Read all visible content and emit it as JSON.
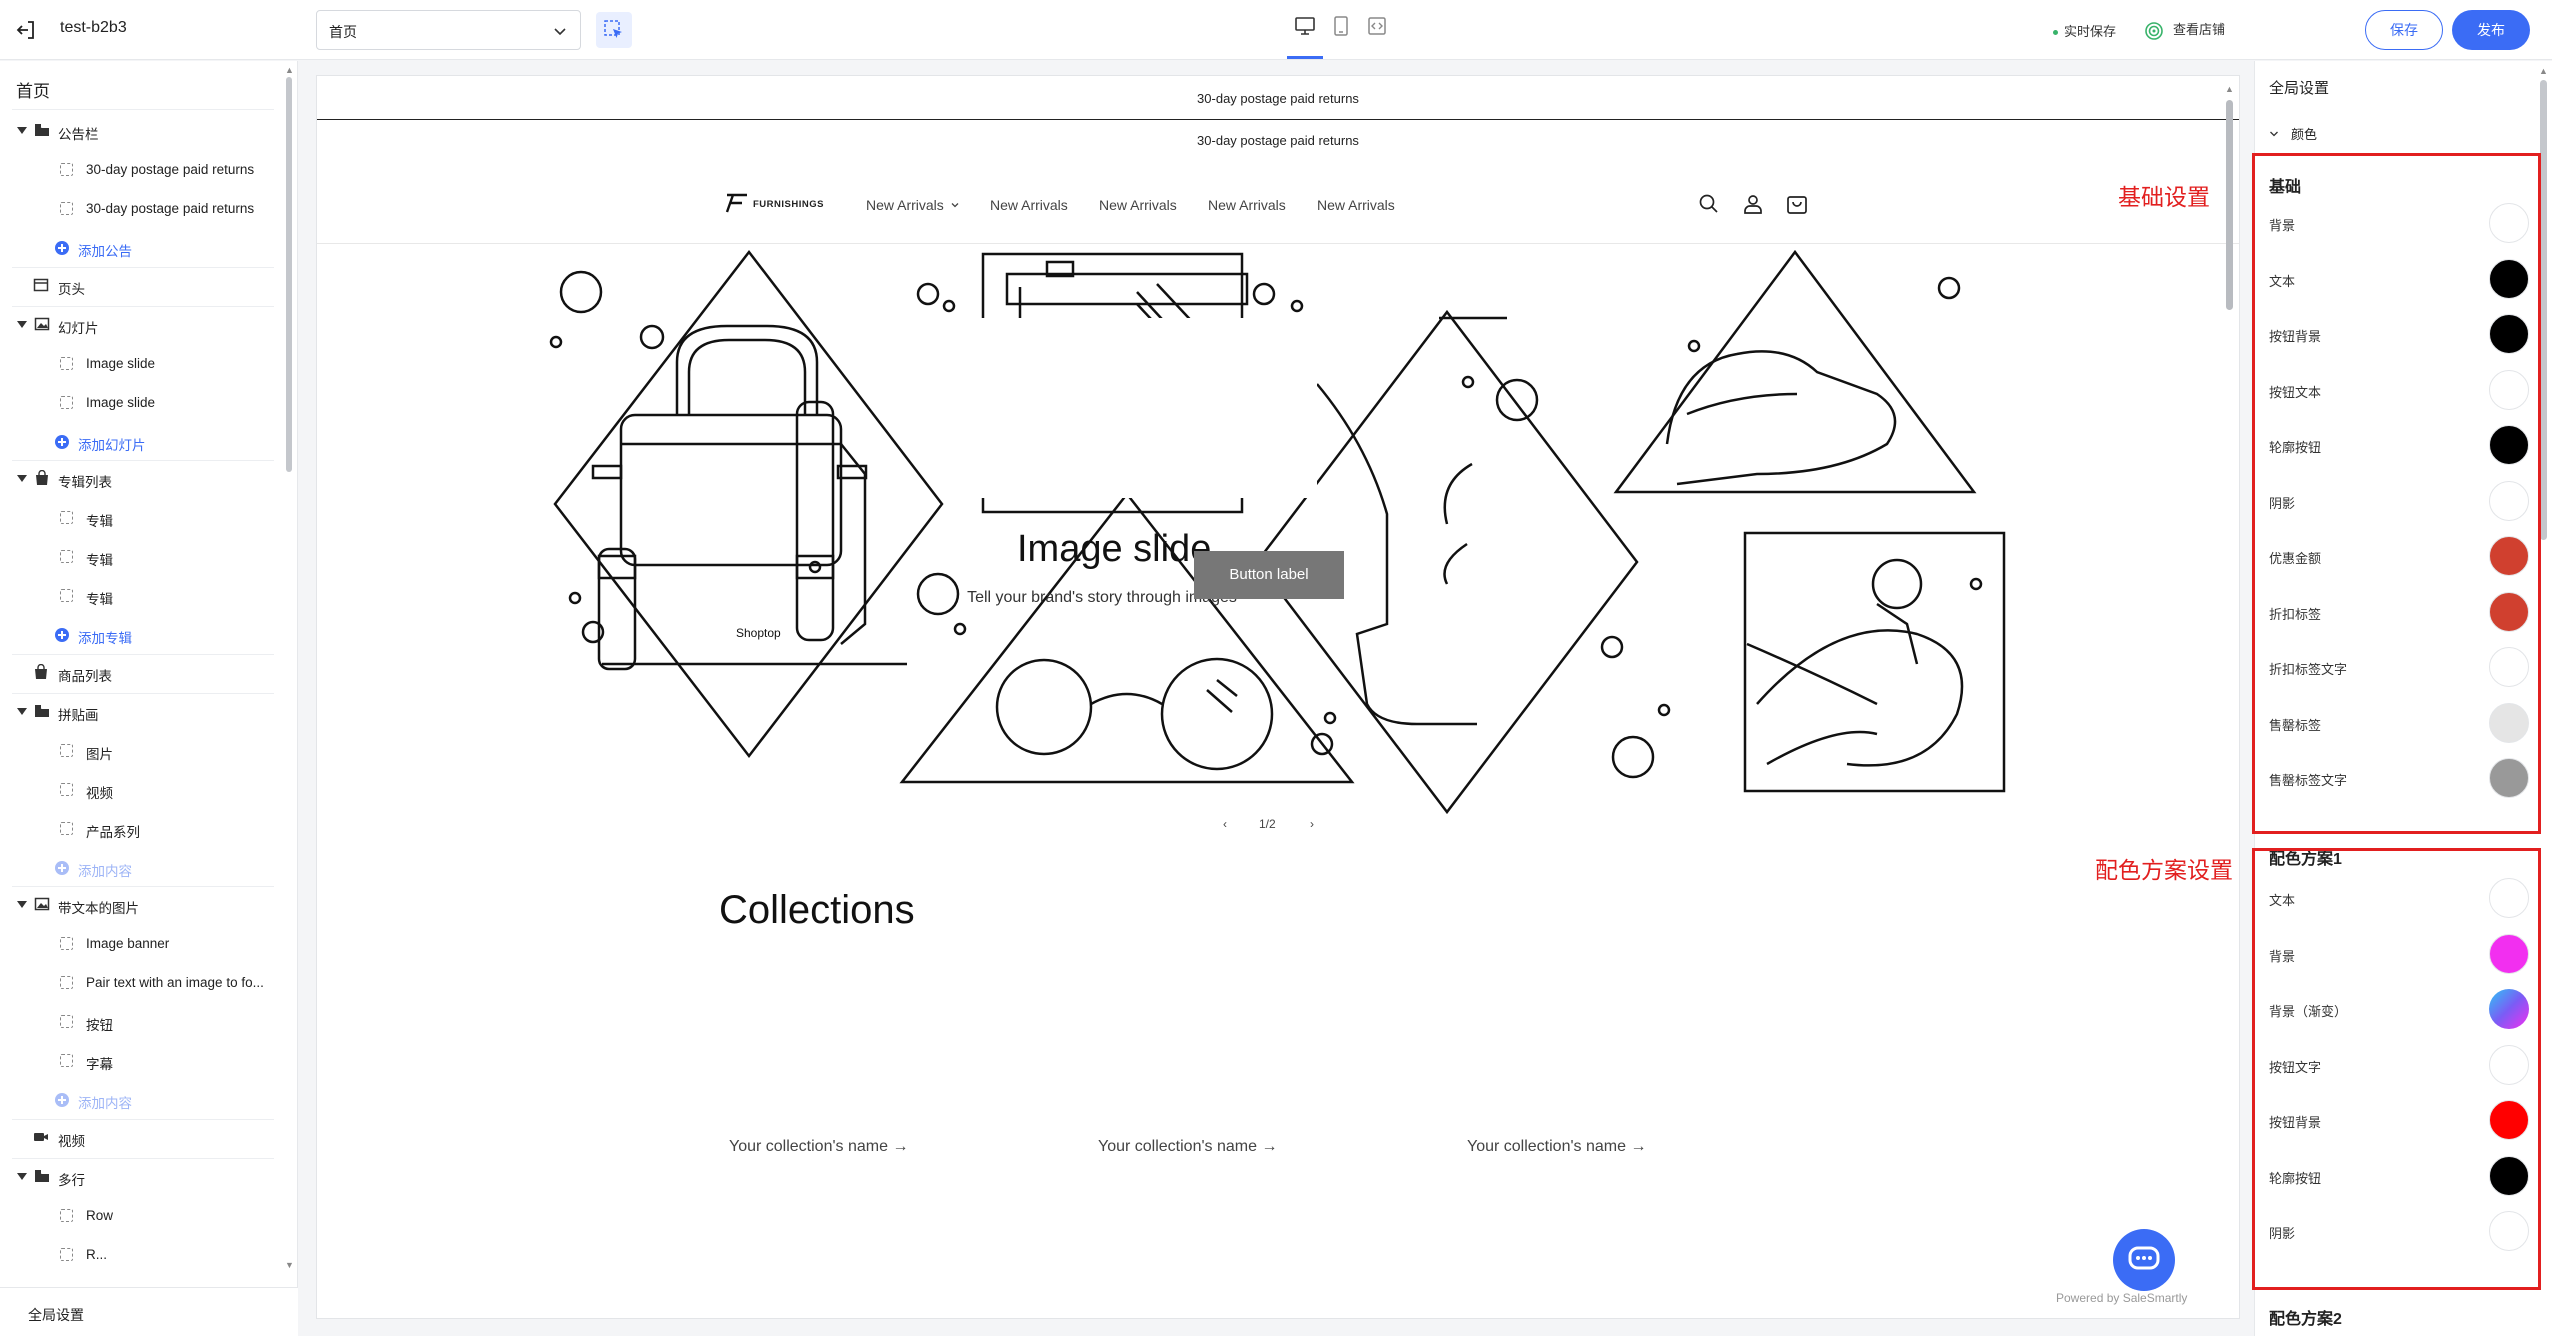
{
  "topbar": {
    "store_name": "test-b2b3",
    "page_select_value": "首页",
    "autosave_label": "实时保存",
    "view_store_label": "查看店铺",
    "save_label": "保存",
    "publish_label": "发布",
    "accent_color": "#3b6cf5"
  },
  "left": {
    "title": "首页",
    "items": [
      {
        "label": "公告栏",
        "kind": "group",
        "icon": "folder-icon"
      },
      {
        "label": "30-day postage paid returns",
        "kind": "child"
      },
      {
        "label": "30-day postage paid returns",
        "kind": "child"
      },
      {
        "label": "添加公告",
        "kind": "add"
      },
      {
        "label": "页头",
        "kind": "section",
        "icon": "layout-icon"
      },
      {
        "label": "幻灯片",
        "kind": "group",
        "icon": "image-icon"
      },
      {
        "label": "Image slide",
        "kind": "child"
      },
      {
        "label": "Image slide",
        "kind": "child"
      },
      {
        "label": "添加幻灯片",
        "kind": "add"
      },
      {
        "label": "专辑列表",
        "kind": "group",
        "icon": "bag-icon"
      },
      {
        "label": "专辑",
        "kind": "child"
      },
      {
        "label": "专辑",
        "kind": "child"
      },
      {
        "label": "专辑",
        "kind": "child"
      },
      {
        "label": "添加专辑",
        "kind": "add"
      },
      {
        "label": "商品列表",
        "kind": "section",
        "icon": "bag-icon"
      },
      {
        "label": "拼贴画",
        "kind": "group",
        "icon": "folder-icon"
      },
      {
        "label": "图片",
        "kind": "child"
      },
      {
        "label": "视频",
        "kind": "child"
      },
      {
        "label": "产品系列",
        "kind": "child"
      },
      {
        "label": "添加内容",
        "kind": "add-muted"
      },
      {
        "label": "带文本的图片",
        "kind": "group",
        "icon": "image-icon"
      },
      {
        "label": "Image banner",
        "kind": "child"
      },
      {
        "label": "Pair text with an image to fo...",
        "kind": "child"
      },
      {
        "label": "按钮",
        "kind": "child"
      },
      {
        "label": "字幕",
        "kind": "child"
      },
      {
        "label": "添加内容",
        "kind": "add-muted"
      },
      {
        "label": "视频",
        "kind": "section",
        "icon": "video-icon"
      },
      {
        "label": "多行",
        "kind": "group",
        "icon": "folder-icon"
      },
      {
        "label": "Row",
        "kind": "child"
      },
      {
        "label": "R...",
        "kind": "child"
      }
    ],
    "bottom_label": "全局设置"
  },
  "preview": {
    "announcement_1": "30-day postage paid returns",
    "announcement_2": "30-day postage paid returns",
    "logo_text": "FURNISHINGS",
    "nav": [
      "New Arrivals",
      "New Arrivals",
      "New Arrivals",
      "New Arrivals",
      "New Arrivals"
    ],
    "bag_brand": "Shoptop",
    "hero_title": "Image slide",
    "hero_subtitle": "Tell your brand's story through images",
    "hero_button": "Button label",
    "pager": "1/2",
    "collections_title": "Collections",
    "collection_links": [
      "Your collection's name →",
      "Your collection's name →",
      "Your collection's name →"
    ],
    "powered_by": "Powered by SaleSmartly"
  },
  "right": {
    "title": "全局设置",
    "colors_label": "颜色",
    "basic": {
      "title": "基础",
      "annotation": "基础设置",
      "rows": [
        {
          "label": "背景",
          "color": "#ffffff"
        },
        {
          "label": "文本",
          "color": "#000000"
        },
        {
          "label": "按钮背景",
          "color": "#000000"
        },
        {
          "label": "按钮文本",
          "color": "#ffffff"
        },
        {
          "label": "轮廓按钮",
          "color": "#000000"
        },
        {
          "label": "阴影",
          "color": "#ffffff"
        },
        {
          "label": "优惠金额",
          "color": "#d0402f"
        },
        {
          "label": "折扣标签",
          "color": "#d0402f"
        },
        {
          "label": "折扣标签文字",
          "color": "#ffffff"
        },
        {
          "label": "售罄标签",
          "color": "#e5e5e5"
        },
        {
          "label": "售罄标签文字",
          "color": "#999999"
        }
      ]
    },
    "scheme1": {
      "title": "配色方案1",
      "annotation": "配色方案设置",
      "rows": [
        {
          "label": "文本",
          "color": "#ffffff"
        },
        {
          "label": "背景",
          "color": "#f22ff0"
        },
        {
          "label": "背景（渐变）",
          "color": "gradient"
        },
        {
          "label": "按钮文字",
          "color": "#ffffff"
        },
        {
          "label": "按钮背景",
          "color": "#ff0000"
        },
        {
          "label": "轮廓按钮",
          "color": "#000000"
        },
        {
          "label": "阴影",
          "color": "#ffffff"
        }
      ]
    },
    "scheme2_title": "配色方案2"
  }
}
